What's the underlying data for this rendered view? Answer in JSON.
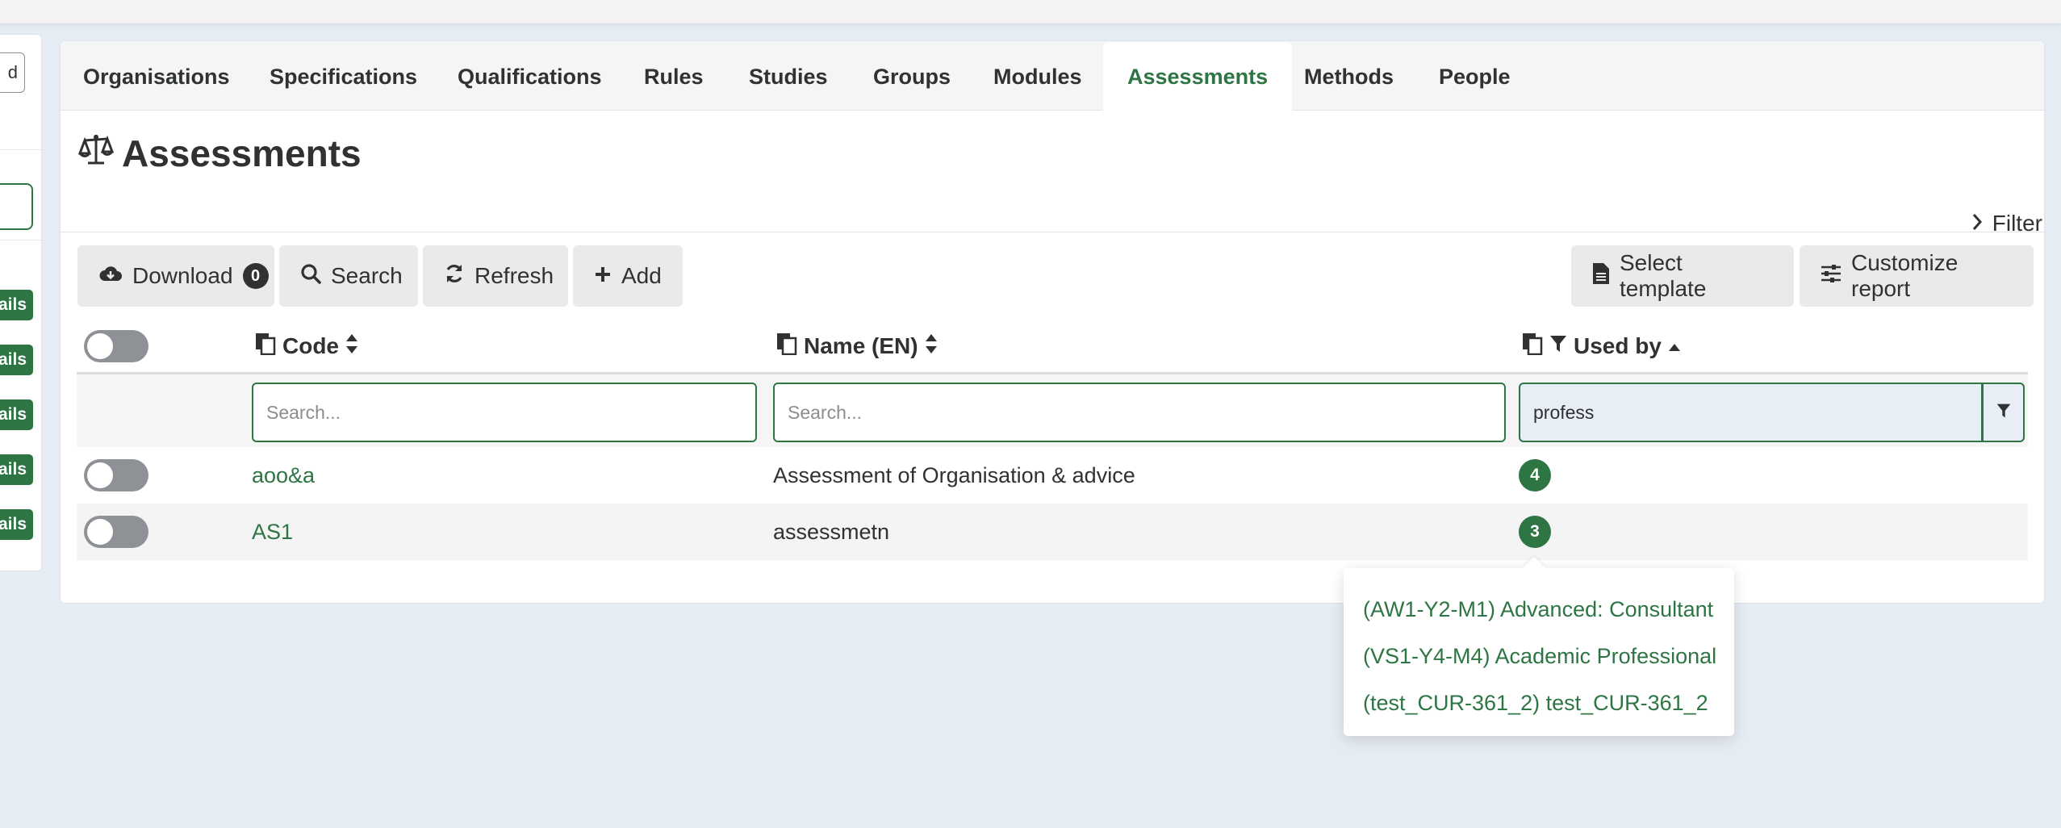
{
  "tabs": [
    {
      "label": "Organisations"
    },
    {
      "label": "Specifications"
    },
    {
      "label": "Qualifications"
    },
    {
      "label": "Rules"
    },
    {
      "label": "Studies"
    },
    {
      "label": "Groups"
    },
    {
      "label": "Modules"
    },
    {
      "label": "Assessments",
      "active": true
    },
    {
      "label": "Methods"
    },
    {
      "label": "People"
    }
  ],
  "sidebar": {
    "button_label": "d",
    "badge_label": "ails"
  },
  "page": {
    "title": "Assessments",
    "title_icon": "balance-scale-icon",
    "filter_label": "Filter"
  },
  "toolbar": {
    "download_label": "Download",
    "download_count": "0",
    "search_label": "Search",
    "refresh_label": "Refresh",
    "add_label": "Add",
    "select_template_label": "Select template",
    "customize_report_label": "Customize report"
  },
  "table": {
    "columns": {
      "code": "Code",
      "name": "Name (EN)",
      "used_by": "Used by"
    },
    "filters": {
      "code_placeholder": "Search...",
      "name_placeholder": "Search...",
      "used_by_value": "profess"
    },
    "rows": [
      {
        "code": "aoo&a",
        "name": "Assessment of Organisation & advice",
        "used_by": "4"
      },
      {
        "code": "AS1",
        "name": "assessmetn",
        "used_by": "3"
      }
    ]
  },
  "popover": {
    "items": [
      "(AW1-Y2-M1) Advanced: Consultant",
      "(VS1-Y4-M4) Academic Professional",
      "(test_CUR-361_2) test_CUR-361_2"
    ]
  },
  "colors": {
    "accent": "#2e7544",
    "background": "#e6ecf3"
  }
}
